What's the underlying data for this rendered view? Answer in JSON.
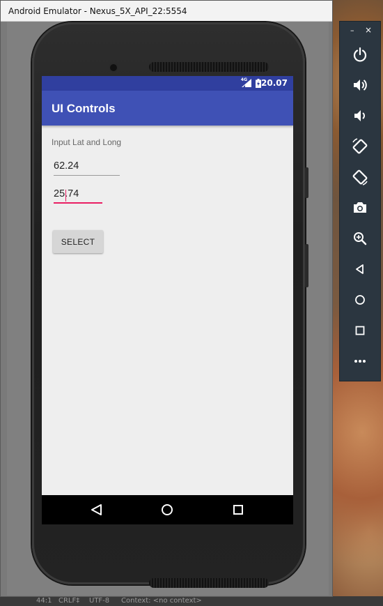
{
  "window": {
    "title": "Android Emulator - Nexus_5X_API_22:5554"
  },
  "statusbar": {
    "network": "4G",
    "time": "20.07"
  },
  "app": {
    "title": "UI Controls",
    "label": "Input Lat and Long",
    "lat_value": "62.24",
    "long_value": "25.74",
    "select_button": "SELECT"
  },
  "colors": {
    "primary": "#3F51B5",
    "primary_dark": "#303F9F",
    "accent": "#E91E63",
    "background": "#EEEEEE"
  },
  "toolbar": {
    "items": [
      {
        "icon": "minimize-icon"
      },
      {
        "icon": "close-icon"
      },
      {
        "icon": "power-icon"
      },
      {
        "icon": "volume-up-icon"
      },
      {
        "icon": "volume-down-icon"
      },
      {
        "icon": "rotate-left-icon"
      },
      {
        "icon": "rotate-right-icon"
      },
      {
        "icon": "camera-icon"
      },
      {
        "icon": "zoom-icon"
      },
      {
        "icon": "back-icon"
      },
      {
        "icon": "home-icon"
      },
      {
        "icon": "overview-icon"
      },
      {
        "icon": "more-icon"
      }
    ]
  },
  "ide_statusbar": {
    "position": "44:1",
    "line_endings": "CRLF‡",
    "encoding": "UTF-8",
    "context": "Context: <no context>"
  }
}
